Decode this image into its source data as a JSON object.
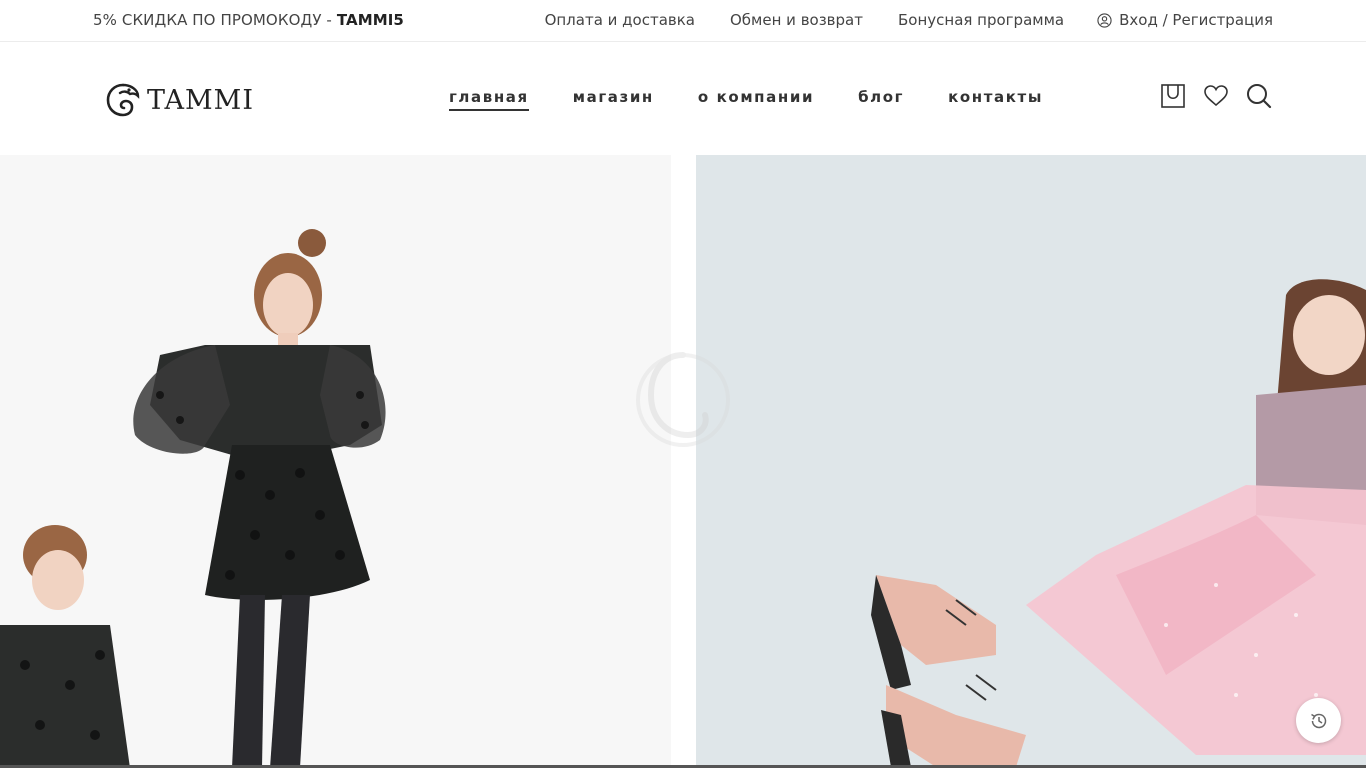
{
  "topbar": {
    "promo_text": "5% СКИДКА ПО ПРОМОКОДУ - ",
    "promo_code": "TAMMI5",
    "links": [
      "Оплата и доставка",
      "Обмен и возврат",
      "Бонусная программа"
    ],
    "login_label": "Вход / Регистрация",
    "login_icon": "user-icon"
  },
  "header": {
    "logo_text": "TAMMI",
    "nav": [
      {
        "label": "главная",
        "active": true
      },
      {
        "label": "магазин",
        "active": false
      },
      {
        "label": "о компании",
        "active": false
      },
      {
        "label": "блог",
        "active": false
      },
      {
        "label": "контакты",
        "active": false
      }
    ],
    "icons": [
      "cart-icon",
      "heart-icon",
      "search-icon"
    ]
  },
  "hero": {
    "slides": [
      {
        "name": "girls-black-polka-dot-dress",
        "background": "#f7f7f7"
      },
      {
        "name": "girl-pink-tulle-skirt-boots",
        "background": "#dfe6e9"
      }
    ],
    "watermark": "TAMMI"
  },
  "colors": {
    "text": "#333333",
    "border": "#ececec",
    "hero_left_bg": "#f7f7f7",
    "hero_right_bg": "#dfe6e9"
  },
  "history_icon": "history-icon"
}
